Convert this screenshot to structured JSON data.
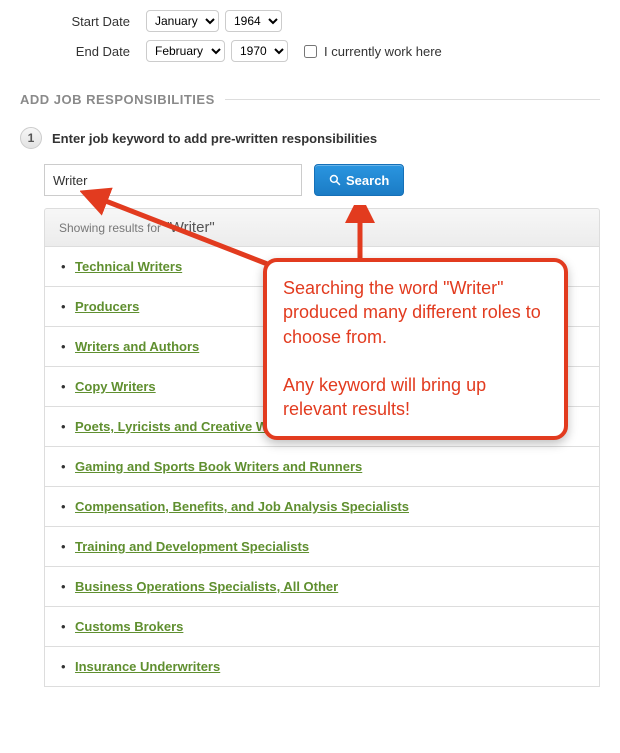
{
  "dates": {
    "start_label": "Start Date",
    "start_month": "January",
    "start_year": "1964",
    "end_label": "End Date",
    "end_month": "February",
    "end_year": "1970",
    "current_label": "I currently work here"
  },
  "section": {
    "title": "ADD JOB RESPONSIBILITIES"
  },
  "step": {
    "number": "1",
    "text": "Enter job keyword to add pre-written responsibilities"
  },
  "search": {
    "value": "Writer",
    "button": "Search"
  },
  "results": {
    "prefix": "Showing results for",
    "term": "\"Writer\"",
    "items": [
      "Technical Writers",
      "Producers",
      "Writers and Authors",
      "Copy Writers",
      "Poets, Lyricists and Creative Writers",
      "Gaming and Sports Book Writers and Runners",
      "Compensation, Benefits, and Job Analysis Specialists",
      "Training and Development Specialists",
      "Business Operations Specialists, All Other",
      "Customs Brokers",
      "Insurance Underwriters"
    ]
  },
  "callout": {
    "line1": "Searching the word \"Writer\" produced many different roles to choose from.",
    "line2": "Any keyword will bring up relevant results!"
  }
}
